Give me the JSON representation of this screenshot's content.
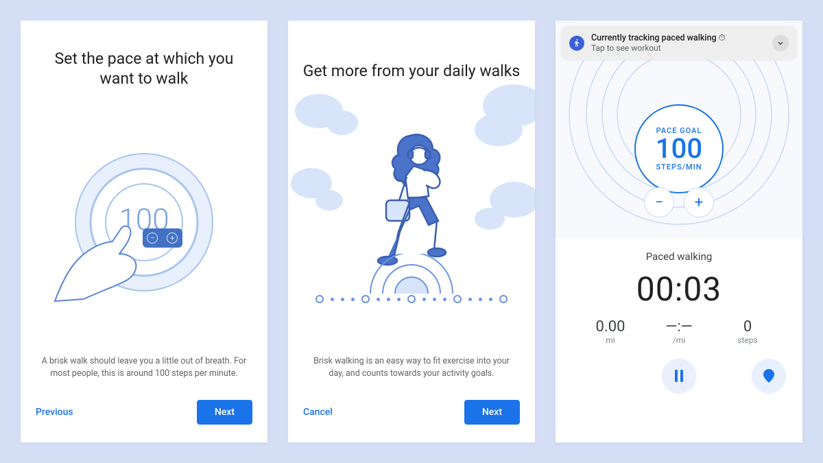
{
  "colors": {
    "primary": "#1a73e8",
    "illu": "#6b95e0",
    "illu_fill": "#e8f0fe"
  },
  "screen1": {
    "title": "Set the pace at which you want to walk",
    "dial_value": "100",
    "description": "A brisk walk should leave you a little out of breath. For most people, this is around 100 steps per minute.",
    "previous_label": "Previous",
    "next_label": "Next"
  },
  "screen2": {
    "title": "Get more from your daily walks",
    "description": "Brisk walking is an easy way to fit exercise into your day, and counts towards your activity goals.",
    "cancel_label": "Cancel",
    "next_label": "Next"
  },
  "screen3": {
    "notification": {
      "title": "Currently tracking paced walking ⏱",
      "subtitle": "Tap to see workout"
    },
    "pace": {
      "label_top": "PACE GOAL",
      "value": "100",
      "label_bottom": "STEPS/MIN"
    },
    "activity_name": "Paced walking",
    "elapsed": "00:03",
    "stats": {
      "distance": {
        "value": "0.00",
        "unit": "mi"
      },
      "pace": {
        "value": "—:—",
        "unit": "/mi"
      },
      "steps": {
        "value": "0",
        "unit": "steps"
      }
    }
  }
}
